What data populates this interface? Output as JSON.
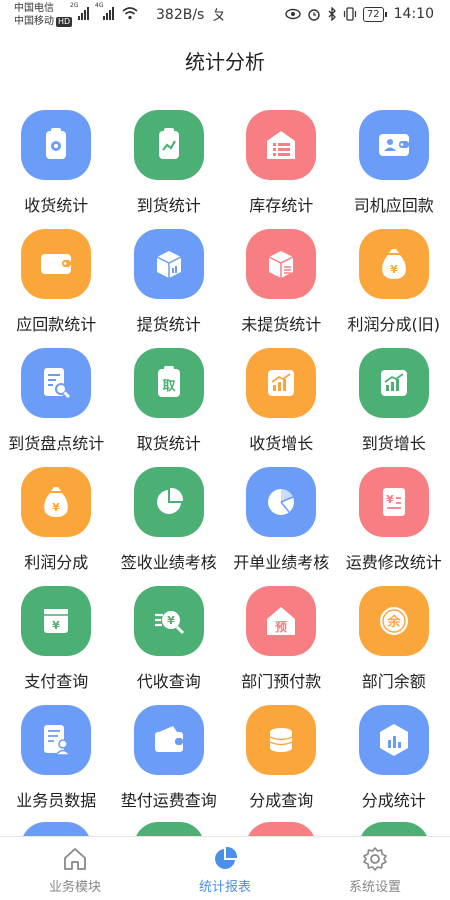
{
  "status_bar": {
    "carrier1": "中国电信",
    "carrier2": "中国移动",
    "hd": "HD",
    "net1": "2G",
    "net2": "4G",
    "speed": "382B/s",
    "misc": "ㄆ",
    "battery": "72",
    "time": "14:10"
  },
  "header": {
    "title": "统计分析"
  },
  "colors": {
    "blue": "#6b9cf7",
    "green": "#4caf73",
    "red": "#f77e82",
    "orange": "#fba63b",
    "nav_active": "#4a8fe8",
    "nav_inactive": "#888888"
  },
  "grid": [
    {
      "label": "收货统计",
      "color": "#6b9cf7",
      "icon": "clipboard-circle-icon"
    },
    {
      "label": "到货统计",
      "color": "#4caf73",
      "icon": "clipboard-chart-icon"
    },
    {
      "label": "库存统计",
      "color": "#f77e82",
      "icon": "warehouse-list-icon"
    },
    {
      "label": "司机应回款",
      "color": "#6b9cf7",
      "icon": "driver-wallet-icon"
    },
    {
      "label": "应回款统计",
      "color": "#fba63b",
      "icon": "wallet-icon"
    },
    {
      "label": "提货统计",
      "color": "#6b9cf7",
      "icon": "box-chart-icon"
    },
    {
      "label": "未提货统计",
      "color": "#f77e82",
      "icon": "box-lines-icon"
    },
    {
      "label": "利润分成(旧)",
      "color": "#fba63b",
      "icon": "money-bag-icon"
    },
    {
      "label": "到货盘点统计",
      "color": "#6b9cf7",
      "icon": "document-search-icon"
    },
    {
      "label": "取货统计",
      "color": "#4caf73",
      "icon": "clipboard-take-icon"
    },
    {
      "label": "收货增长",
      "color": "#fba63b",
      "icon": "growth-chart-icon"
    },
    {
      "label": "到货增长",
      "color": "#4caf73",
      "icon": "growth-chart-icon"
    },
    {
      "label": "利润分成",
      "color": "#fba63b",
      "icon": "money-bag-icon"
    },
    {
      "label": "签收业绩考核",
      "color": "#4caf73",
      "icon": "pie-chart-icon"
    },
    {
      "label": "开单业绩考核",
      "color": "#6b9cf7",
      "icon": "pie-slice-icon"
    },
    {
      "label": "运费修改统计",
      "color": "#f77e82",
      "icon": "yen-document-icon"
    },
    {
      "label": "支付查询",
      "color": "#4caf73",
      "icon": "yen-card-icon"
    },
    {
      "label": "代收查询",
      "color": "#4caf73",
      "icon": "yen-search-icon"
    },
    {
      "label": "部门预付款",
      "color": "#f77e82",
      "icon": "house-prepay-icon"
    },
    {
      "label": "部门余额",
      "color": "#fba63b",
      "icon": "balance-circle-icon"
    },
    {
      "label": "业务员数据",
      "color": "#6b9cf7",
      "icon": "salesman-document-icon"
    },
    {
      "label": "垫付运费查询",
      "color": "#6b9cf7",
      "icon": "wallet-card-icon"
    },
    {
      "label": "分成查询",
      "color": "#fba63b",
      "icon": "coin-stack-icon"
    },
    {
      "label": "分成统计",
      "color": "#6b9cf7",
      "icon": "hexagon-chart-icon"
    }
  ],
  "partial_row_colors": [
    "#6b9cf7",
    "#4caf73",
    "#f77e82",
    "#4caf73"
  ],
  "house_prepay_char": "预",
  "balance_char": "余",
  "take_char": "取",
  "nav": [
    {
      "label": "业务模块",
      "icon": "home-icon",
      "active": false
    },
    {
      "label": "统计报表",
      "icon": "pie-chart-icon",
      "active": true
    },
    {
      "label": "系统设置",
      "icon": "gear-icon",
      "active": false
    }
  ]
}
